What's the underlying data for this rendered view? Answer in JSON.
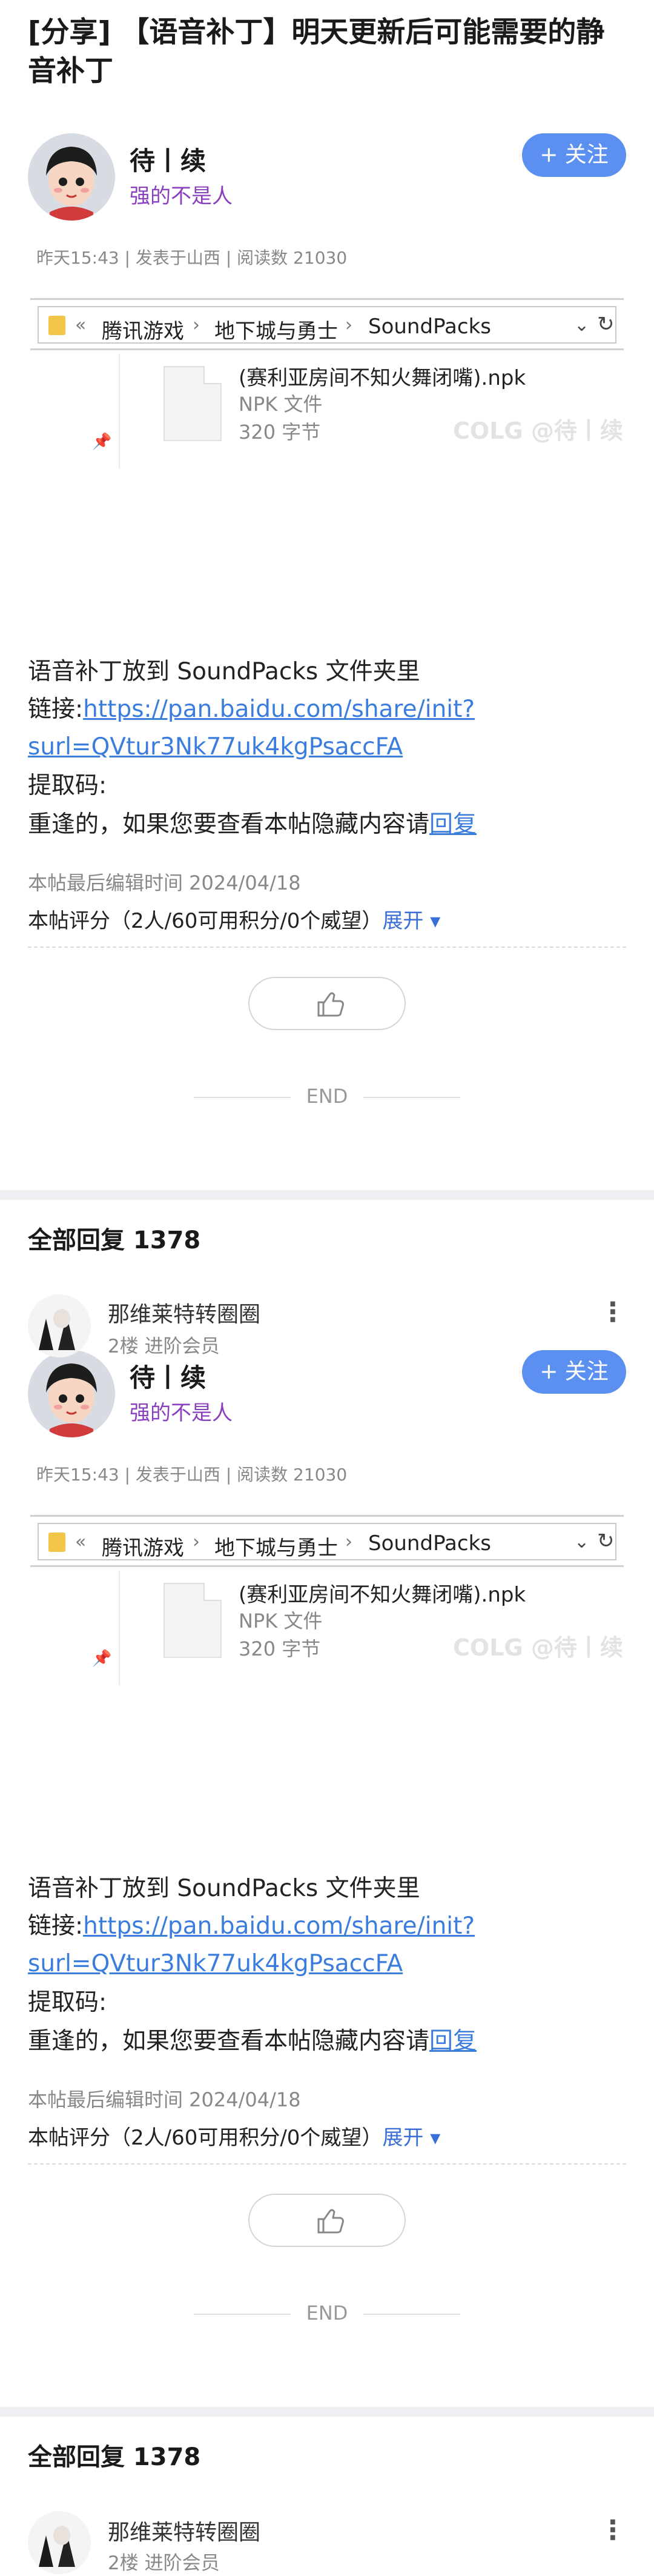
{
  "post": {
    "title": "[分享] 【语音补丁】明天更新后可能需要的静音补丁"
  },
  "author": {
    "name": "待丨续",
    "title": "强的不是人",
    "follow_label": "+ 关注"
  },
  "meta": {
    "text": "昨天15:43 | 发表于山西 | 阅读数 21030"
  },
  "explorer": {
    "back": "«",
    "crumbs": [
      "腾讯游戏",
      "地下城与勇士",
      "SoundPacks"
    ],
    "sep": "›",
    "dropdown": "⌄",
    "refresh": "↻",
    "file_name": "(赛利亚房间不知火舞闭嘴).npk",
    "file_type": "NPK 文件",
    "file_size": "320 字节",
    "watermark": "COLG @待丨续",
    "pin": "📌"
  },
  "content": {
    "line1": "语音补丁放到 SoundPacks 文件夹里",
    "link_prefix": "链接:",
    "link_part1": "https://pan.baidu.com/share/init?",
    "link_part2": "surl=QVtur3Nk77uk4kgPsaccFA",
    "code_label": "提取码:",
    "hidden_prefix": "重逢的，如果您要查看本帖隐藏内容请",
    "hidden_link": "回复",
    "edit_note": "本帖最后编辑时间 2024/04/18",
    "rating_text": "本帖评分（2人/60可用积分/0个威望）",
    "rating_expand": "展开 ▾",
    "end_label": "END"
  },
  "replies": {
    "header": "全部回复  1378",
    "first": {
      "name": "那维莱特转圈圈",
      "sub": "2楼 进阶会员",
      "more": "⋮"
    }
  }
}
